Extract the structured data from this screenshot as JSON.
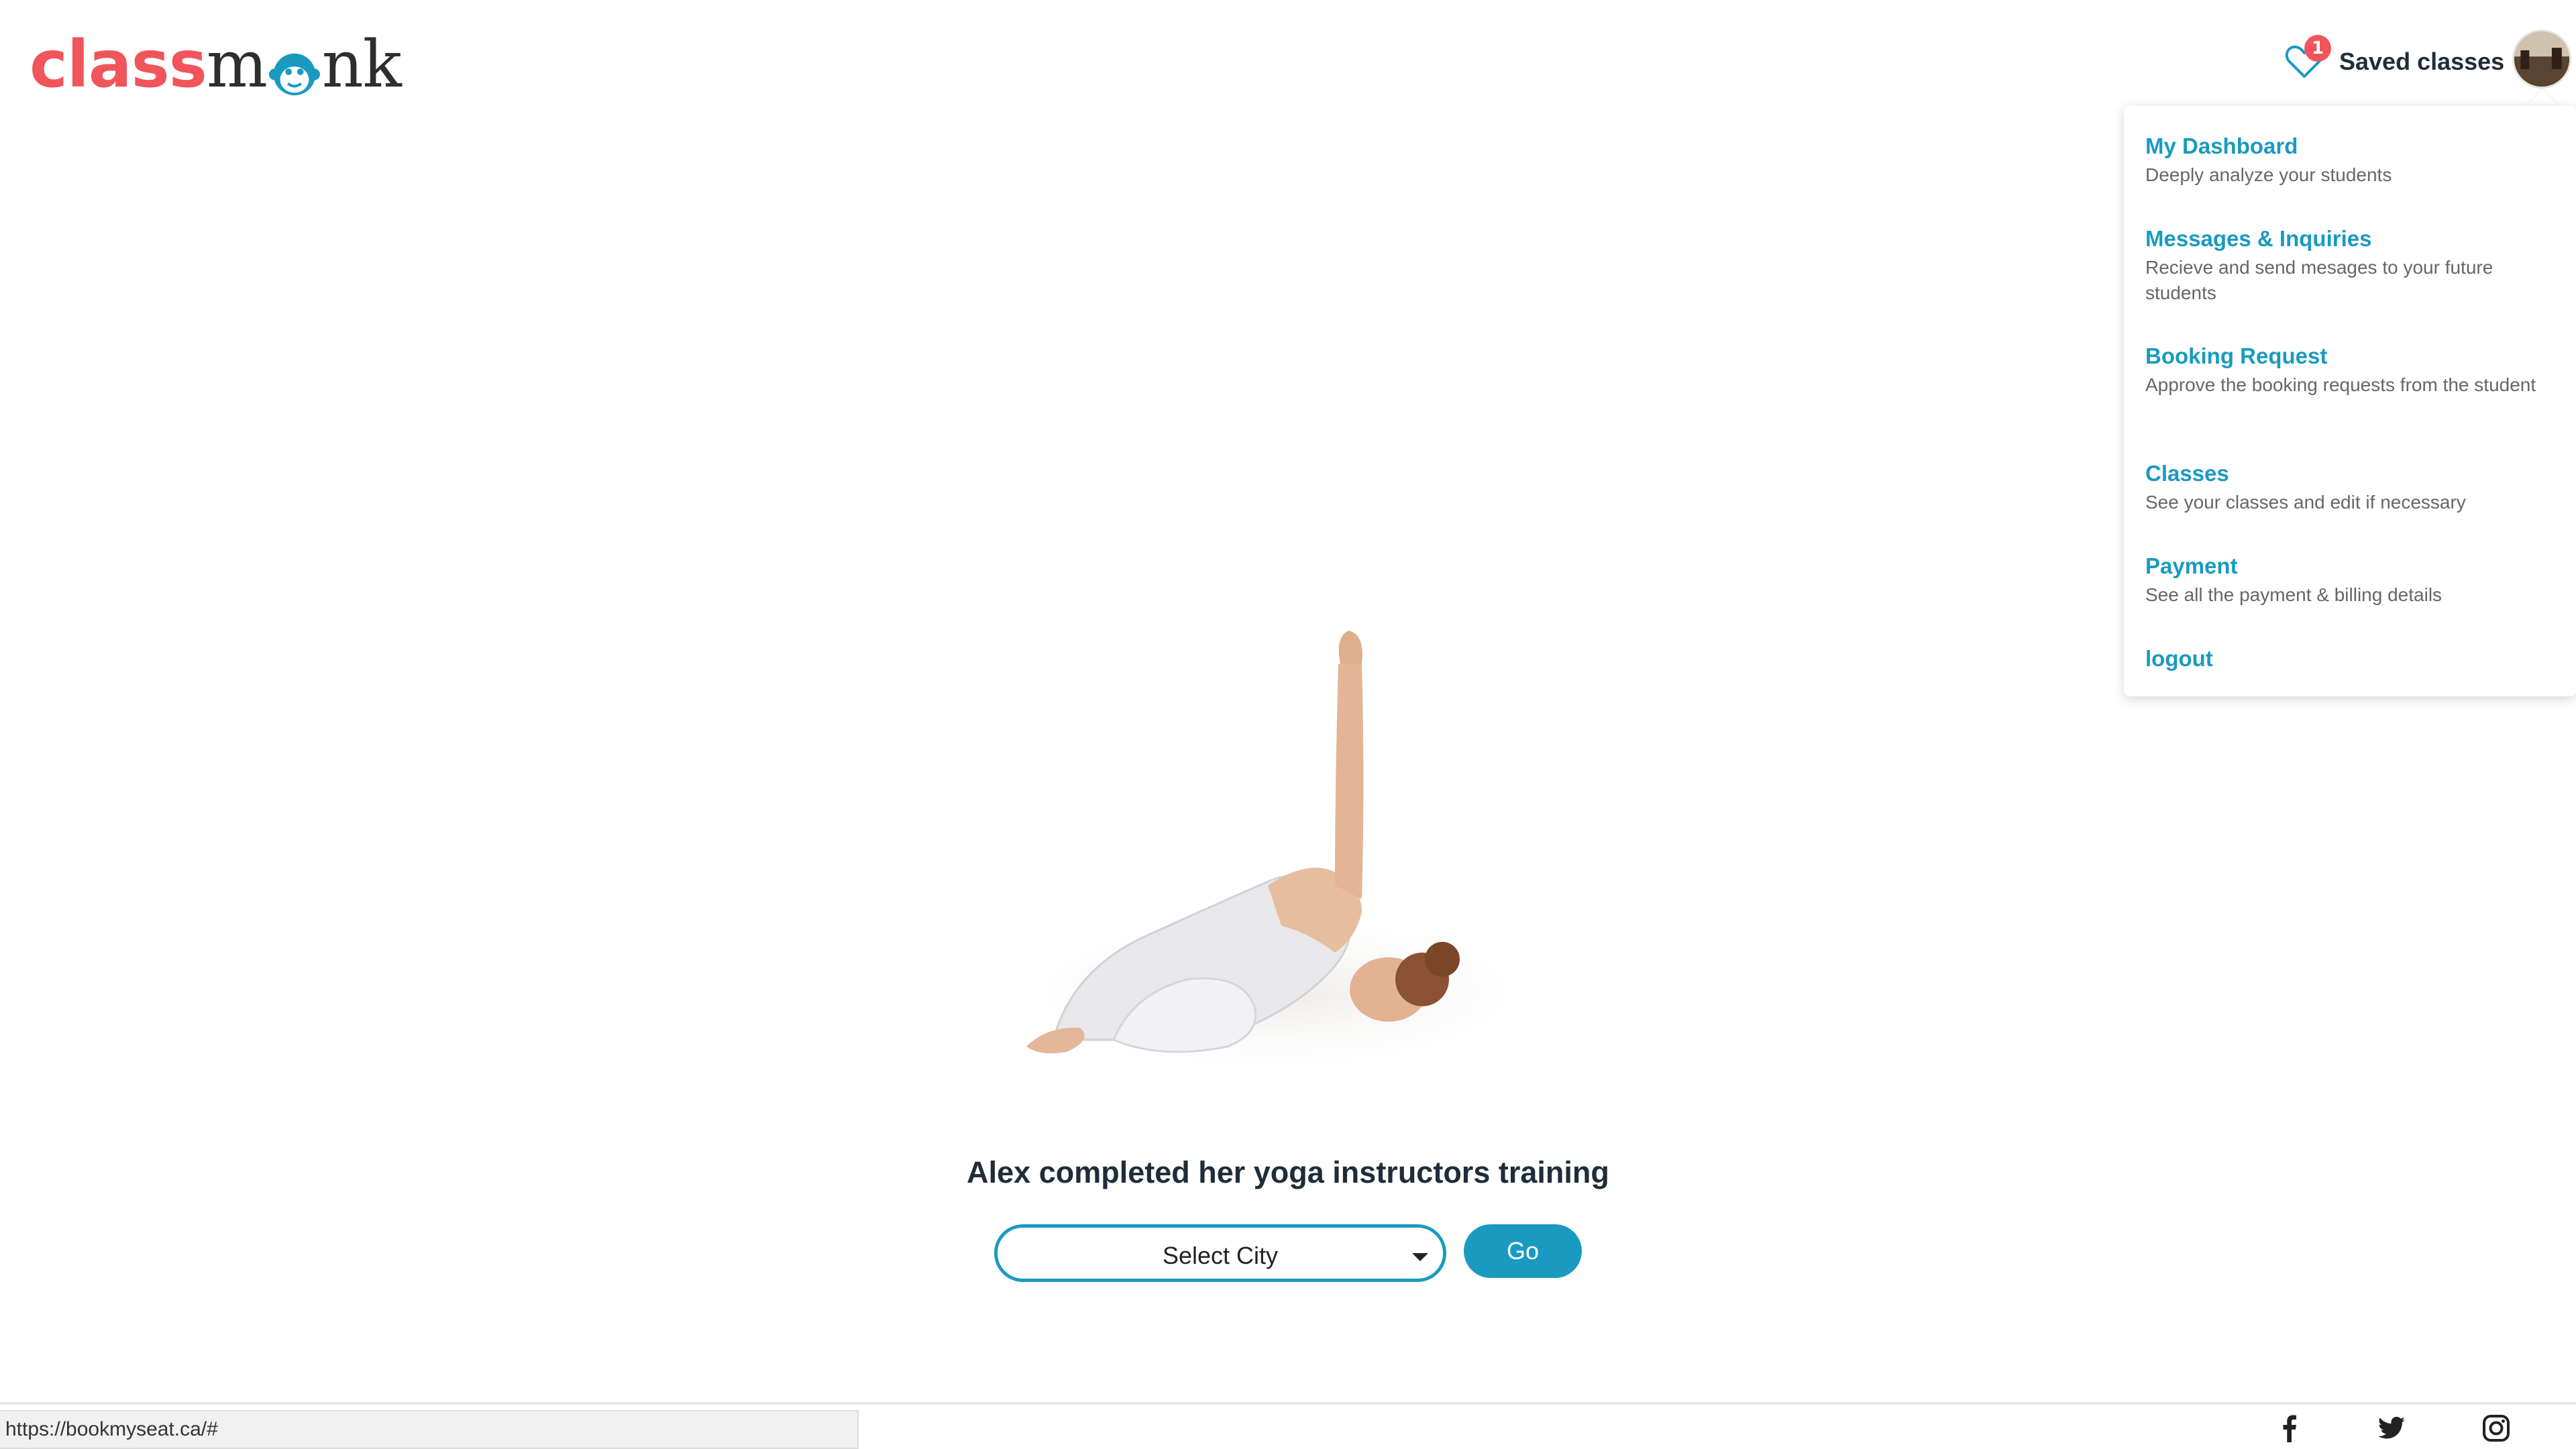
{
  "logo": {
    "part1": "class",
    "part2a": "m",
    "part2b": "nk"
  },
  "header": {
    "saved_label": "Saved classes",
    "saved_count": "1"
  },
  "menu": {
    "items": [
      {
        "title": "My Dashboard",
        "desc": "Deeply analyze your students"
      },
      {
        "title": "Messages & Inquiries",
        "desc": "Recieve and send mesages to your future students"
      },
      {
        "title": "Booking Request",
        "desc": "Approve the booking requests from the student"
      },
      {
        "title": "Classes",
        "desc": "See your classes and edit if necessary"
      },
      {
        "title": "Payment",
        "desc": "See all the payment & billing details"
      },
      {
        "title": "logout",
        "desc": ""
      }
    ]
  },
  "hero": {
    "headline": "Alex completed her yoga instructors training",
    "city_select": "Select City",
    "go_label": "Go"
  },
  "status_url": "https://bookmyseat.ca/#",
  "colors": {
    "accent": "#1a9ac0",
    "brand_red": "#f0555b",
    "text": "#1f2d3a"
  },
  "icons": [
    "heart-icon",
    "monkey-icon",
    "facebook-icon",
    "twitter-icon",
    "instagram-icon"
  ]
}
